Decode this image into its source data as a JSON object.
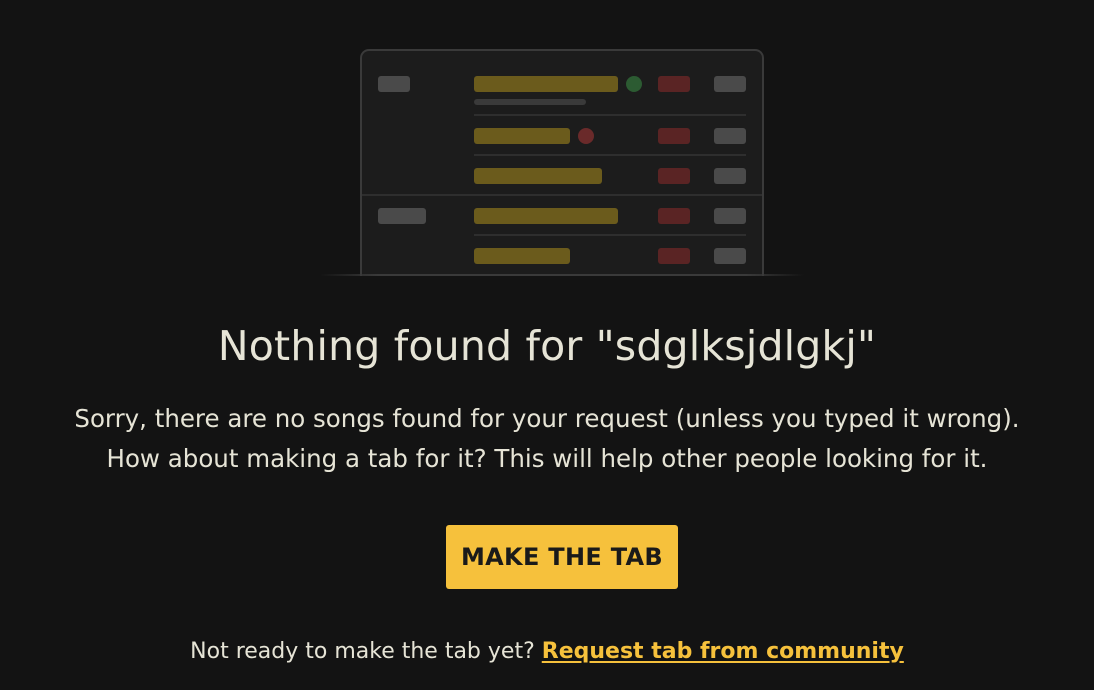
{
  "empty_state": {
    "title": "Nothing found for \"sdglksjdlgkj\"",
    "description_line1": "Sorry, there are no songs found for your request (unless you typed it wrong).",
    "description_line2": "How about making a tab for it? This will help other people looking for it.",
    "cta_label": "MAKE THE TAB",
    "footer_prompt": "Not ready to make the tab yet?",
    "footer_link": "Request tab from community"
  },
  "illustration": {
    "name": "empty-results-illustration",
    "colors": {
      "frame": "#1c1c1c",
      "placeholder_gray": "#4a4a4a",
      "placeholder_yellow": "#6b5b1c",
      "placeholder_red": "#5a2424",
      "dot_green": "#2c5b32",
      "dot_red": "#6a2a2a"
    }
  },
  "theme": {
    "background": "#131313",
    "text": "#e6e4d6",
    "accent": "#f6c13c"
  }
}
